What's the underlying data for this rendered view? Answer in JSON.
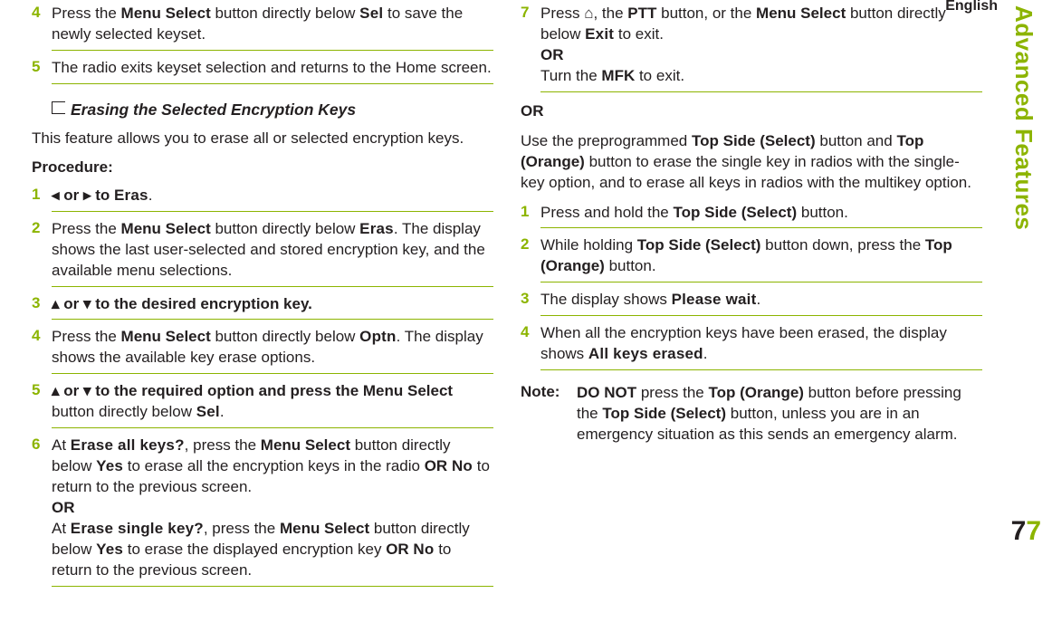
{
  "english_label": "English",
  "side_heading": "Advanced Features",
  "page_number_dark": "7",
  "page_number_light": "7",
  "left": {
    "s4a": "Press the ",
    "s4b": "Menu Select",
    "s4c": " button directly below ",
    "s4d": "Sel",
    "s4e": " to save the newly selected keyset.",
    "s5": "The radio exits keyset selection and returns to the Home screen.",
    "section_title": "Erasing the Selected Encryption Keys",
    "intro": "This feature allows you to erase all or selected encryption keys.",
    "proc": "Procedure:",
    "e1a": "◂ or ▸ to ",
    "e1b": "Eras",
    "e1c": ".",
    "e2a": "Press the ",
    "e2b": "Menu Select",
    "e2c": " button directly below ",
    "e2d": "Eras",
    "e2e": ". The display shows the last user-selected and stored encryption key, and the available menu selections.",
    "e3a": "▴ or ▾ to the desired encryption key.",
    "e4a": "Press the ",
    "e4b": "Menu Select",
    "e4c": " button directly below ",
    "e4d": "Optn",
    "e4e": ". The display shows the available key erase options.",
    "e5a": "▴ or ▾ to the required option and press the ",
    "e5b": "Menu Select",
    "e5c": " button directly below ",
    "e5d": "Sel",
    "e5e": ".",
    "e6a": "At ",
    "e6b": "Erase all keys?",
    "e6c": ", press the ",
    "e6d": "Menu Select",
    "e6e": " button directly below ",
    "e6f": "Yes",
    "e6g": " to erase all the encryption keys in the radio ",
    "e6h": "OR",
    "e6i": " ",
    "e6j": "No",
    "e6k": " to return to the previous screen.",
    "e6or": "OR",
    "e6l": "At ",
    "e6m": "Erase single key?",
    "e6n": ", press the ",
    "e6o": "Menu Select",
    "e6p": " button directly below ",
    "e6q": "Yes",
    "e6r": " to erase the displayed encryption key ",
    "e6s": "OR",
    "e6t": " ",
    "e6u": "No",
    "e6v": " to return to the previous screen."
  },
  "right": {
    "r7a": "Press ",
    "r7home": "⌂",
    "r7b": ", the ",
    "r7c": "PTT",
    "r7d": " button, or the ",
    "r7e": "Menu Select",
    "r7f": " button directly below ",
    "r7g": "Exit",
    "r7h": " to exit.",
    "r7or": "OR",
    "r7i": "Turn the ",
    "r7j": "MFK",
    "r7k": " to exit.",
    "or": "OR",
    "p1a": "Use the preprogrammed ",
    "p1b": "Top Side (Select)",
    "p1c": " button and ",
    "p1d": "Top (Orange)",
    "p1e": " button to erase the single key in radios with the single-key option, and to erase all keys in radios with the multikey option.",
    "q1a": "Press and hold the ",
    "q1b": "Top Side (Select)",
    "q1c": " button.",
    "q2a": "While holding ",
    "q2b": "Top Side (Select)",
    "q2c": " button down, press the ",
    "q2d": "Top (Orange)",
    "q2e": " button.",
    "q3a": "The display shows ",
    "q3b": "Please wait",
    "q3c": ".",
    "q4a": "When all the encryption keys have been erased, the display shows ",
    "q4b": "All keys erased",
    "q4c": ".",
    "note_label": "Note:",
    "na": "DO NOT",
    "nb": " press the ",
    "nc": "Top (Orange)",
    "nd": " button before pressing the ",
    "ne": "Top Side (Select)",
    "nf": " button, unless you are in an emergency situation as this sends an emergency alarm."
  }
}
